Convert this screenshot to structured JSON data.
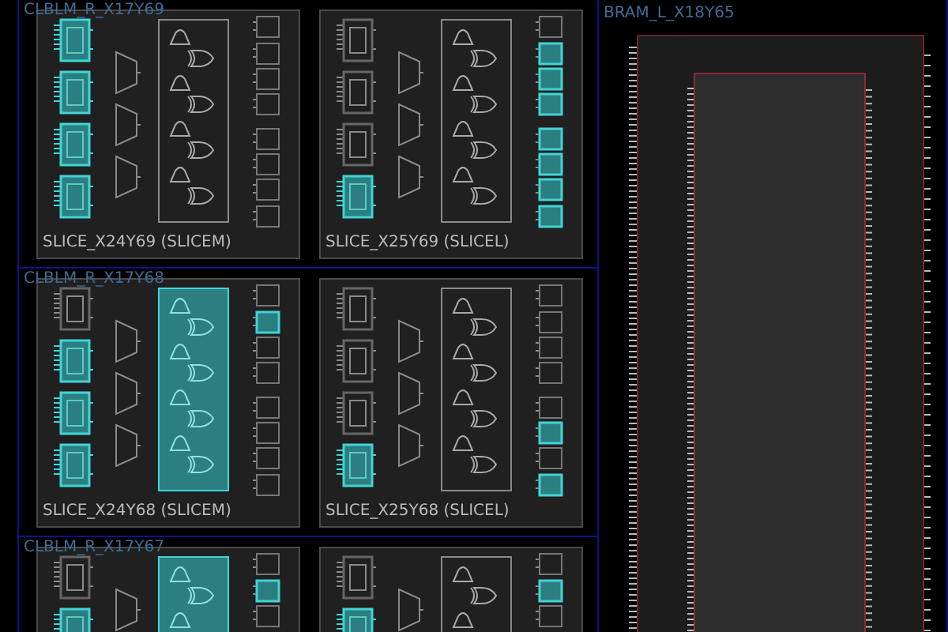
{
  "clb_tiles": [
    {
      "title": "CLBLM_R_X17Y69",
      "slices": [
        {
          "name": "SLICE_X24Y69 (SLICEM)",
          "luts": [
            {
              "used": true
            },
            {
              "used": true
            },
            {
              "used": true
            },
            {
              "used": true
            }
          ],
          "carry": {
            "used": false
          },
          "ffs": [
            {
              "used": false
            },
            {
              "used": false
            },
            {
              "used": false
            },
            {
              "used": false
            },
            {
              "used": false
            },
            {
              "used": false
            },
            {
              "used": false
            },
            {
              "used": false
            }
          ]
        },
        {
          "name": "SLICE_X25Y69 (SLICEL)",
          "luts": [
            {
              "used": false
            },
            {
              "used": false
            },
            {
              "used": false
            },
            {
              "used": true
            }
          ],
          "carry": {
            "used": false
          },
          "ffs": [
            {
              "used": false
            },
            {
              "used": true
            },
            {
              "used": true
            },
            {
              "used": true
            },
            {
              "used": true
            },
            {
              "used": true
            },
            {
              "used": true
            },
            {
              "used": true
            }
          ]
        }
      ]
    },
    {
      "title": "CLBLM_R_X17Y68",
      "slices": [
        {
          "name": "SLICE_X24Y68 (SLICEM)",
          "luts": [
            {
              "used": false
            },
            {
              "used": true
            },
            {
              "used": true
            },
            {
              "used": true
            }
          ],
          "carry": {
            "used": true
          },
          "ffs": [
            {
              "used": false
            },
            {
              "used": true
            },
            {
              "used": false
            },
            {
              "used": false
            },
            {
              "used": false
            },
            {
              "used": false
            },
            {
              "used": false
            },
            {
              "used": false
            }
          ]
        },
        {
          "name": "SLICE_X25Y68 (SLICEL)",
          "luts": [
            {
              "used": false
            },
            {
              "used": false
            },
            {
              "used": false
            },
            {
              "used": true
            }
          ],
          "carry": {
            "used": false
          },
          "ffs": [
            {
              "used": false
            },
            {
              "used": false
            },
            {
              "used": false
            },
            {
              "used": false
            },
            {
              "used": false
            },
            {
              "used": true
            },
            {
              "used": false
            },
            {
              "used": true
            }
          ]
        }
      ]
    },
    {
      "title": "CLBLM_R_X17Y67",
      "slices": [
        {
          "luts": [
            {
              "used": false
            },
            {
              "used": true
            }
          ],
          "carry": {
            "used": true
          },
          "ffs": [
            {
              "used": false
            },
            {
              "used": true
            },
            {
              "used": false
            }
          ]
        },
        {
          "luts": [
            {
              "used": false
            },
            {
              "used": true
            }
          ],
          "carry": {
            "used": false
          },
          "ffs": [
            {
              "used": false
            },
            {
              "used": true
            },
            {
              "used": false
            }
          ]
        }
      ]
    }
  ],
  "bram_tile": {
    "title": "BRAM_L_X18Y65"
  }
}
